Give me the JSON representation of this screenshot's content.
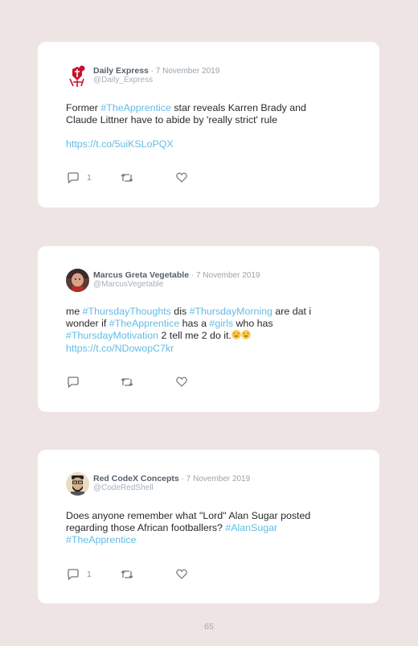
{
  "tweets": [
    {
      "name": "Daily Express",
      "handle": "@Daily_Express",
      "date": "7 November 2019",
      "text_parts": [
        {
          "t": "Former "
        },
        {
          "t": "#TheApprentice",
          "tag": true
        },
        {
          "t": " star reveals Karren Brady and Claude Littner have to abide by 'really strict' rule"
        }
      ],
      "link": "https://t.co/5uiKSLoPQX",
      "reply_count": "1",
      "avatar_icon": "daily-express-crusader-logo"
    },
    {
      "name": "Marcus Greta Vegetable",
      "handle": "@MarcusVegetable",
      "date": "7 November 2019",
      "text_parts": [
        {
          "t": "me "
        },
        {
          "t": "#ThursdayThoughts",
          "tag": true
        },
        {
          "t": " dis "
        },
        {
          "t": "#ThursdayMorning",
          "tag": true
        },
        {
          "t": " are dat i wonder if "
        },
        {
          "t": "#TheApprentice",
          "tag": true
        },
        {
          "t": " has a "
        },
        {
          "t": "#girls",
          "tag": true
        },
        {
          "t": " who has "
        },
        {
          "t": "#ThursdayMotivation",
          "tag": true
        },
        {
          "t": " 2 tell me 2 do it."
        },
        {
          "emoji": "smiling-face-with-heart-eyes"
        },
        {
          "emoji": "smiling-face-with-heart-eyes"
        },
        {
          "br": true
        },
        {
          "t": "https://t.co/NDowopC7kr",
          "link": true
        }
      ],
      "link": "",
      "reply_count": "",
      "avatar_icon": "user-photo"
    },
    {
      "name": "Red CodeX Concepts",
      "handle": "@CodeRedShell",
      "date": "7 November 2019",
      "text_parts": [
        {
          "t": "Does anyone remember what \"Lord\" Alan Sugar posted regarding those African footballers? "
        },
        {
          "t": "#AlanSugar",
          "tag": true
        },
        {
          "br": true
        },
        {
          "t": "#TheApprentice",
          "tag": true
        }
      ],
      "link": "",
      "reply_count": "1",
      "avatar_icon": "bearded-cartoon-avatar"
    }
  ],
  "separator": " · ",
  "page_number": "65",
  "colors": {
    "background": "#efe4e4",
    "card": "#ffffff",
    "link": "#62bce6",
    "icon": "#6e7780"
  },
  "icons": [
    "reply-icon",
    "retweet-icon",
    "like-icon"
  ]
}
